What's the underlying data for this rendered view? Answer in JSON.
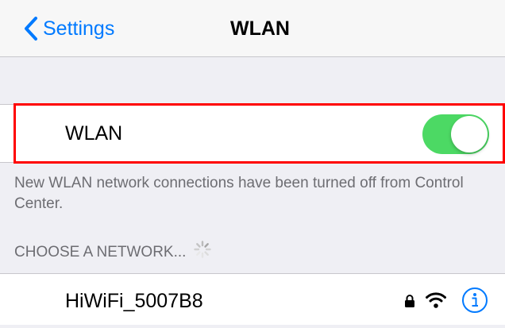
{
  "nav": {
    "back_label": "Settings",
    "title": "WLAN"
  },
  "wlan": {
    "label": "WLAN",
    "enabled": true
  },
  "footnote": "New WLAN network connections have been turned off from Control Center.",
  "section": {
    "header": "CHOOSE A NETWORK..."
  },
  "networks": [
    {
      "name": "HiWiFi_5007B8",
      "secured": true
    }
  ],
  "colors": {
    "accent": "#007aff",
    "toggle_on": "#4cd964",
    "highlight": "#ff0000",
    "background": "#efeff4"
  },
  "icons": {
    "back": "chevron-left-icon",
    "lock": "lock-icon",
    "wifi": "wifi-icon",
    "info": "info-icon",
    "loading": "spinner-icon"
  }
}
